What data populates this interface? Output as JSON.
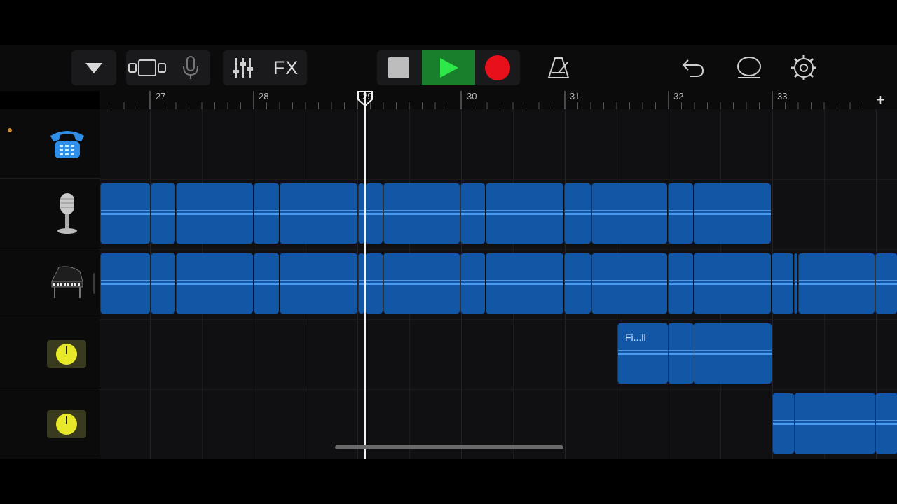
{
  "toolbar": {
    "fx_label": "FX",
    "icons": {
      "tracks_menu": "triangle-down-icon",
      "view_toggle": "tracks-view-icon",
      "input": "microphone-icon",
      "controls": "mixer-sliders-icon",
      "stop": "stop-icon",
      "play": "play-icon",
      "record": "record-icon",
      "metronome": "metronome-icon",
      "undo": "undo-icon",
      "loop_browser": "loop-icon",
      "settings": "gear-icon"
    },
    "colors": {
      "play": "#1a7f2c",
      "record": "#e8101a",
      "stop": "#bdbdbd"
    }
  },
  "ruler": {
    "bars": [
      "27",
      "28",
      "29",
      "30",
      "31",
      "32",
      "33"
    ],
    "add_label": "+"
  },
  "tracks": [
    {
      "name": "phone-track",
      "icon": "telephone-icon"
    },
    {
      "name": "vocal-track",
      "icon": "microphone-icon"
    },
    {
      "name": "piano-track",
      "icon": "grand-piano-icon"
    },
    {
      "name": "fx-track-1",
      "icon": "knob-icon"
    },
    {
      "name": "fx-track-2",
      "icon": "knob-icon"
    }
  ],
  "regions": {
    "track4_label": "Fi...ll"
  },
  "colors": {
    "region": "#1257a6",
    "waveform": "#4a9bf0",
    "knob": "#e7e82a"
  }
}
